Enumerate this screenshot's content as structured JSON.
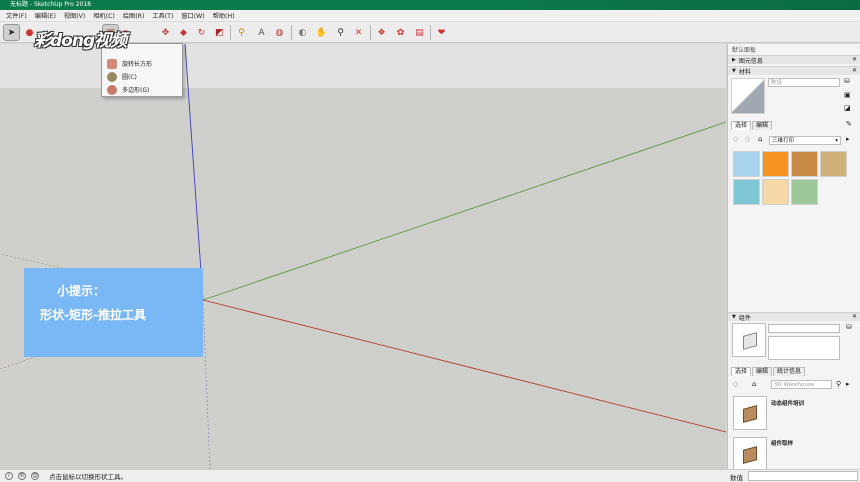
{
  "window": {
    "title": "无标题 - SketchUp Pro 2018"
  },
  "menu": [
    "文件(F)",
    "编辑(E)",
    "视图(V)",
    "相机(C)",
    "绘图(R)",
    "工具(T)",
    "窗口(W)",
    "帮助(H)"
  ],
  "watermark": "彩dong视频",
  "dropdown": {
    "items": [
      {
        "label": "旋转长方形",
        "icon": "rotated-rectangle-icon"
      },
      {
        "label": "圆(C)",
        "icon": "circle-icon"
      },
      {
        "label": "多边形(G)",
        "icon": "polygon-icon"
      }
    ]
  },
  "hint": {
    "line1": "小提示：",
    "line2": "形状-矩形-推拉工具"
  },
  "status": {
    "message": "点击鼠标以切换形状工具。",
    "measure_label": "数值"
  },
  "panel": {
    "title": "默认面板",
    "entity_info": "图元信息",
    "materials": {
      "header": "材料",
      "name_placeholder": "陈设",
      "tab_select": "选择",
      "tab_edit": "编辑",
      "library": "三维打印",
      "swatches": [
        "#a8d4ef",
        "#f79320",
        "#c98a45",
        "#d2b07a",
        "#7ec6d6",
        "#f6d7a8",
        "#9cc89a"
      ]
    },
    "components": {
      "header": "组件",
      "tab_select": "选择",
      "tab_edit": "编辑",
      "tab_stats": "统计信息",
      "search_placeholder": "3D Warehouse",
      "items": [
        "动态组件培训",
        "组件取样"
      ]
    }
  },
  "colors": {
    "titlebar": "#0d7a4c",
    "hint_bg": "#7ab8f5",
    "green_axis": "#5a9a3e",
    "red_axis": "#b2402c",
    "blue_axis": "#3b3fb5"
  }
}
